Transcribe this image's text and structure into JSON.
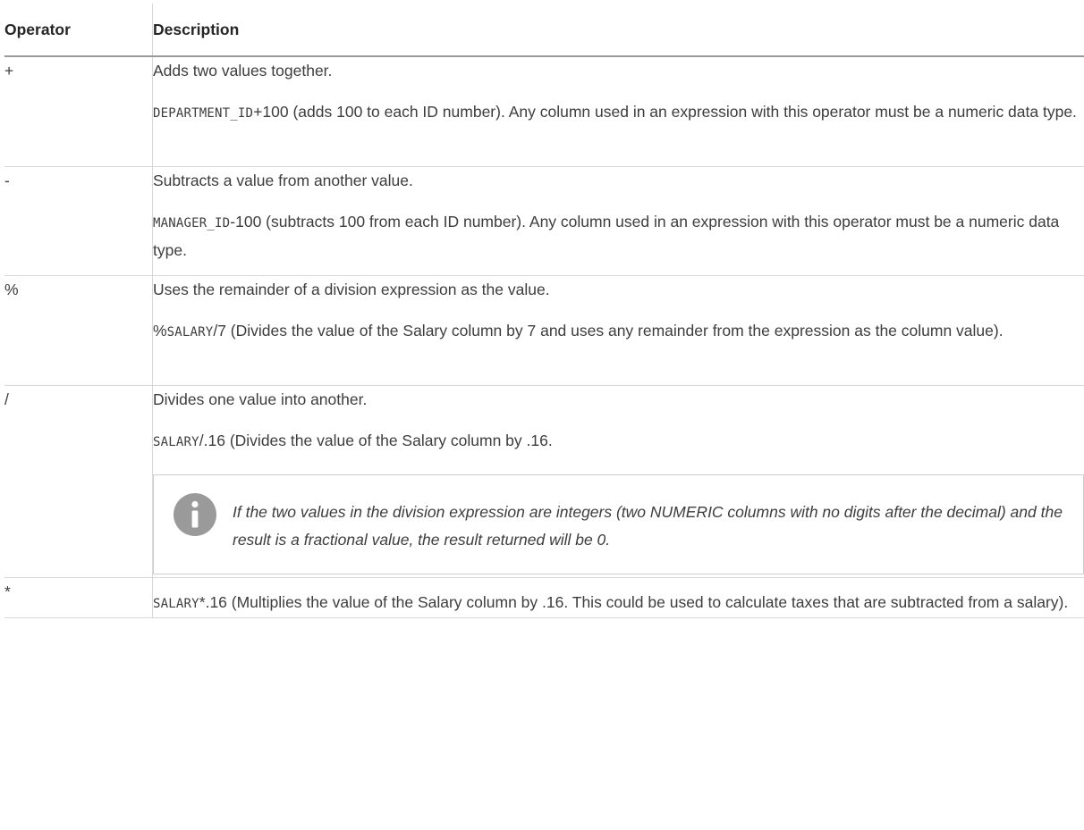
{
  "table": {
    "headers": {
      "operator": "Operator",
      "description": "Description"
    },
    "rows": [
      {
        "operator": "+",
        "desc1": "Adds two values together.",
        "code": "DEPARTMENT_ID",
        "rest": "+100 (adds 100 to each ID number). Any column used in an expression with this operator must be a numeric data type."
      },
      {
        "operator": "-",
        "desc1": "Subtracts a value from another value.",
        "code": "MANAGER_ID",
        "rest": "-100 (subtracts 100 from each ID number). Any column used in an expression with this operator must be a numeric data type."
      },
      {
        "operator": "%",
        "desc1": "Uses the remainder of a division expression as the value.",
        "prefix": "%",
        "code": "SALARY",
        "rest": "/7 (Divides the value of the Salary column by 7 and uses any remainder from the expression as the column value)."
      },
      {
        "operator": "/",
        "desc1": "Divides one value into another.",
        "code": "SALARY",
        "rest": "/.16 (Divides the value of the Salary column by .16.",
        "note": "If the two values in the division expression are integers (two NUMERIC columns with no digits after the decimal) and the result is a fractional value, the result returned will be 0."
      },
      {
        "operator": "*",
        "code": "SALARY",
        "rest": "*.16 (Multiplies the value of the Salary column by .16. This could be used to calculate taxes that are subtracted from a salary)."
      }
    ]
  },
  "icons": {
    "note": "info-icon"
  },
  "colors": {
    "info_icon": "#9a9a9a",
    "border": "#d8d8d8",
    "text": "#3d3d3d"
  }
}
